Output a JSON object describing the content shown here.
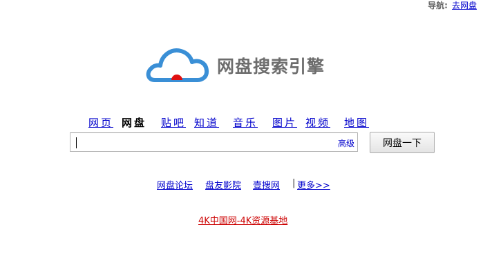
{
  "topnav": {
    "label": "导航:",
    "link": "去网盘"
  },
  "logo": {
    "text": "网盘搜索引擎",
    "cloud_color": "#3a8fd6",
    "dot_color": "#e01010"
  },
  "tabs": {
    "web": "网页",
    "netdisk": "网盘",
    "tieba": "贴吧",
    "zhidao": "知道",
    "music": "音乐",
    "images": "图片",
    "video": "视频",
    "map": "地图"
  },
  "search": {
    "value": "",
    "advanced": "高级",
    "button": "网盘一下"
  },
  "links": {
    "forum": "网盘论坛",
    "cinema": "盘友影院",
    "yisou": "壹搜网",
    "separator": "|",
    "more": "更多>>"
  },
  "promo": "4K中国网-4K资源基地",
  "colors": {
    "link": "#0000cc",
    "promo": "#cc0000",
    "logo_text": "#6d6d6d"
  }
}
